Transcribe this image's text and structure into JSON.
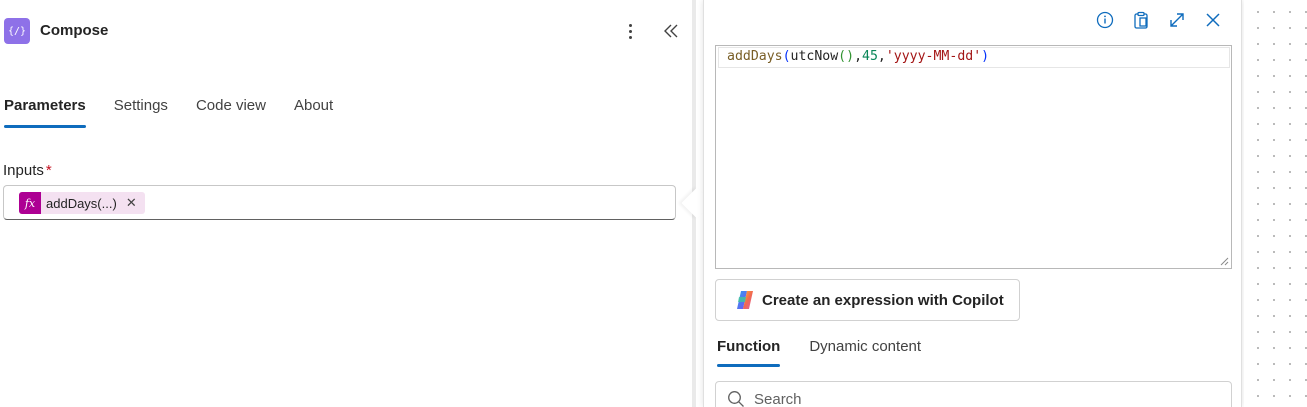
{
  "action": {
    "title": "Compose",
    "icon": "braces-icon",
    "icon_glyph": "{/}",
    "icon_color": "#8e71e8"
  },
  "tabs": [
    {
      "label": "Parameters",
      "active": true
    },
    {
      "label": "Settings",
      "active": false
    },
    {
      "label": "Code view",
      "active": false
    },
    {
      "label": "About",
      "active": false
    }
  ],
  "inputs": {
    "label": "Inputs",
    "required_marker": "*",
    "token": {
      "icon_text": "fx",
      "text": "addDays(...)",
      "remove_glyph": "✕",
      "color": "#ad0093"
    }
  },
  "expression_panel": {
    "tools": [
      "info-icon",
      "paste-icon",
      "expand-icon",
      "close-icon"
    ],
    "editor": {
      "tokens": [
        {
          "text": "addDays",
          "kind": "fn"
        },
        {
          "text": "(",
          "kind": "p1"
        },
        {
          "text": "utcNow",
          "kind": "pl"
        },
        {
          "text": "()",
          "kind": "p2"
        },
        {
          "text": ",",
          "kind": "pl"
        },
        {
          "text": "45",
          "kind": "num"
        },
        {
          "text": ",",
          "kind": "pl"
        },
        {
          "text": "'yyyy-MM-dd'",
          "kind": "str"
        },
        {
          "text": ")",
          "kind": "p1"
        }
      ]
    },
    "copilot_button": "Create an expression with Copilot",
    "tabs": [
      {
        "label": "Function",
        "active": true
      },
      {
        "label": "Dynamic content",
        "active": false
      }
    ],
    "search": {
      "placeholder": "Search",
      "value": ""
    }
  },
  "colors": {
    "accent": "#0f6cbd",
    "required": "#c50f1f"
  }
}
